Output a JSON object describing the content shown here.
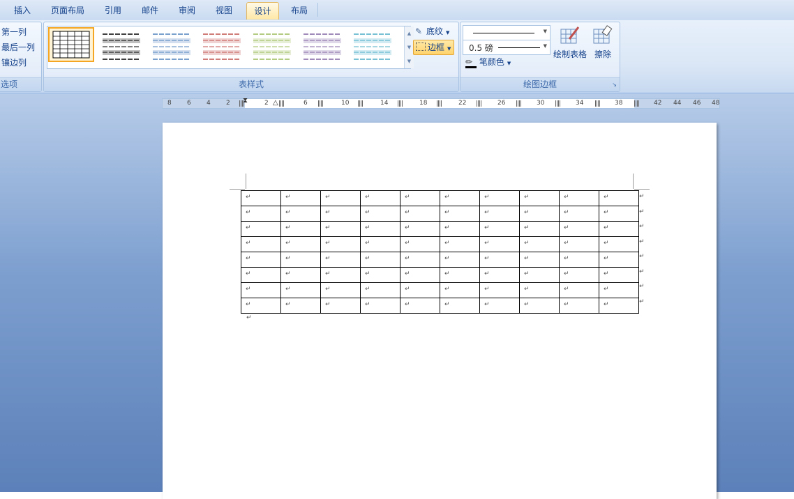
{
  "tabs": [
    "插入",
    "页面布局",
    "引用",
    "邮件",
    "审阅",
    "视图",
    "设计",
    "布局"
  ],
  "active_tab": "设计",
  "options_group": {
    "items": [
      "第一列",
      "最后一列",
      "镶边列"
    ],
    "label": "选项"
  },
  "table_styles_group": {
    "label": "表样式",
    "shading_label": "底纹",
    "borders_label": "边框",
    "style_colors": [
      "#000000",
      "#7f7f7f",
      "#4f81bd",
      "#c0504d",
      "#9bbb59",
      "#8064a2",
      "#4bacc6"
    ]
  },
  "draw_borders_group": {
    "label": "绘图边框",
    "pen_weight": "0.5 磅",
    "pen_color_label": "笔颜色",
    "draw_table_label": "绘制表格",
    "eraser_label": "擦除"
  },
  "ruler": {
    "left_numbers": [
      "8",
      "6",
      "4",
      "2"
    ],
    "right_numbers": [
      "2",
      "6",
      "10",
      "14",
      "18",
      "22",
      "26",
      "30",
      "34",
      "38",
      "42",
      "44",
      "46",
      "48"
    ]
  },
  "document": {
    "rows": 8,
    "cols": 10,
    "cell_mark": "↵"
  }
}
